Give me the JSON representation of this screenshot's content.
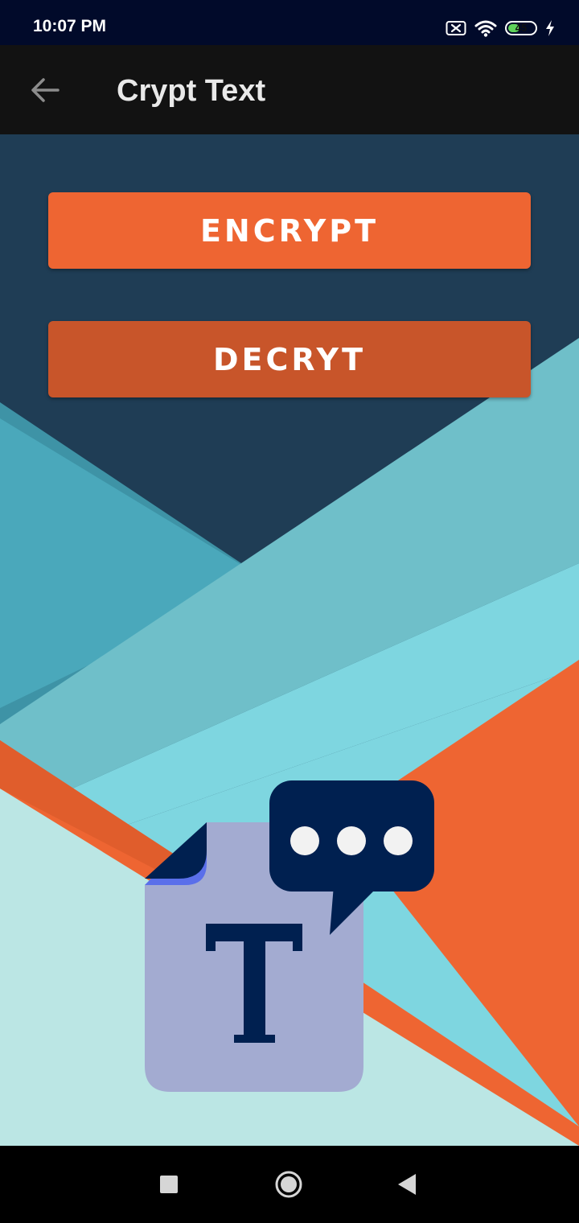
{
  "status_bar": {
    "time": "10:07 PM",
    "battery_level": "45",
    "battery_fraction": 0.45,
    "icons": [
      "sim-off-icon",
      "wifi-icon",
      "battery-icon",
      "charging-icon"
    ]
  },
  "app_bar": {
    "back_icon": "arrow-back-icon",
    "title": "Crypt Text"
  },
  "buttons": {
    "encrypt_label": "ENCRYPT",
    "decrypt_label": "DECRYT"
  },
  "logo": {
    "icons": [
      "document-icon",
      "letter-t-icon",
      "speech-bubble-icon"
    ]
  },
  "nav_bar": {
    "icons": [
      "recents-icon",
      "home-icon",
      "back-triangle-icon"
    ]
  },
  "colors": {
    "encrypt": "#ee6532",
    "decrypt": "#c8552a",
    "app_bar": "#121212",
    "status_bar": "#010a2a"
  }
}
